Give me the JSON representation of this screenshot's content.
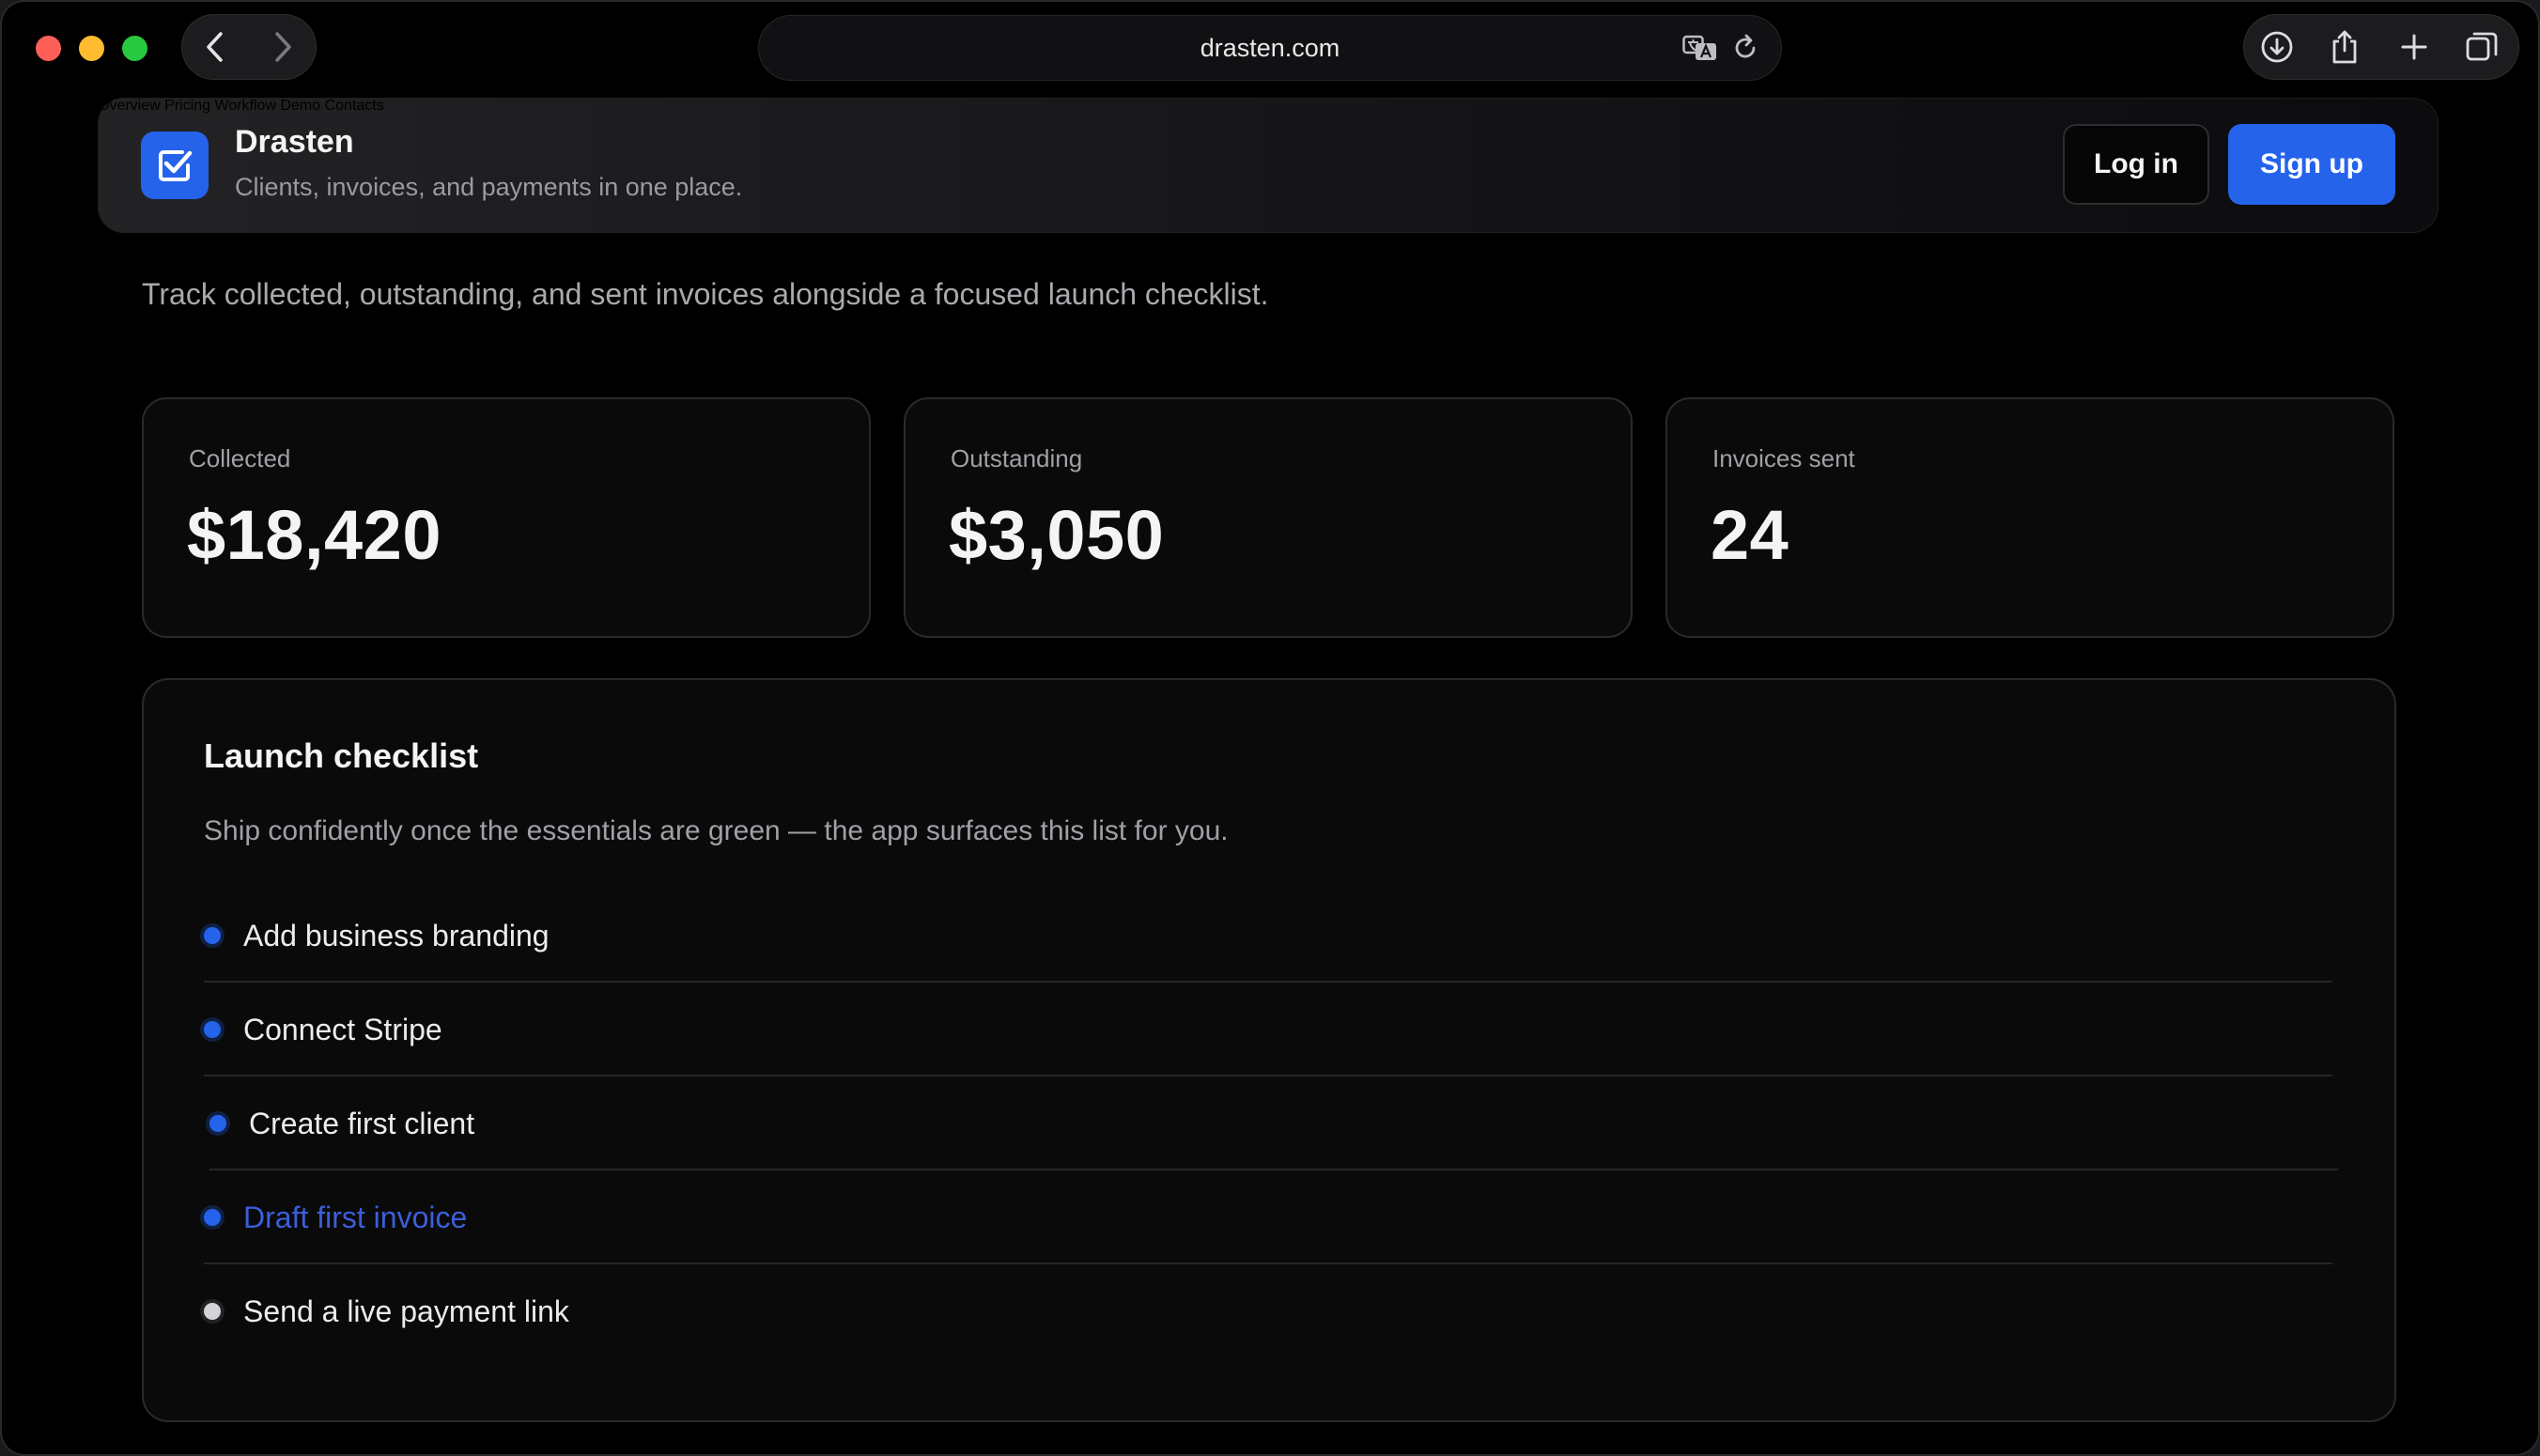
{
  "browser": {
    "url": "drasten.com"
  },
  "site": {
    "brand_name": "Drasten",
    "tagline": "Clients, invoices, and payments in one place.",
    "nav": [
      "Overview",
      "Pricing",
      "Workflow",
      "Demo",
      "Contacts"
    ],
    "login_label": "Log in",
    "signup_label": "Sign up",
    "accent_color": "#2563eb"
  },
  "main": {
    "intro": "Track collected, outstanding, and sent invoices alongside a focused launch checklist.",
    "stats": [
      {
        "label": "Collected",
        "value": "$18,420"
      },
      {
        "label": "Outstanding",
        "value": "$3,050"
      },
      {
        "label": "Invoices sent",
        "value": "24"
      }
    ],
    "checklist": {
      "title": "Launch checklist",
      "subtitle": "Ship confidently once the essentials are green — the app surfaces this list for you.",
      "items": [
        {
          "label": "Add business branding",
          "status": "done"
        },
        {
          "label": "Connect Stripe",
          "status": "done"
        },
        {
          "label": "Create first client",
          "status": "done"
        },
        {
          "label": "Draft first invoice",
          "status": "active"
        },
        {
          "label": "Send a live payment link",
          "status": "pending"
        }
      ]
    }
  }
}
